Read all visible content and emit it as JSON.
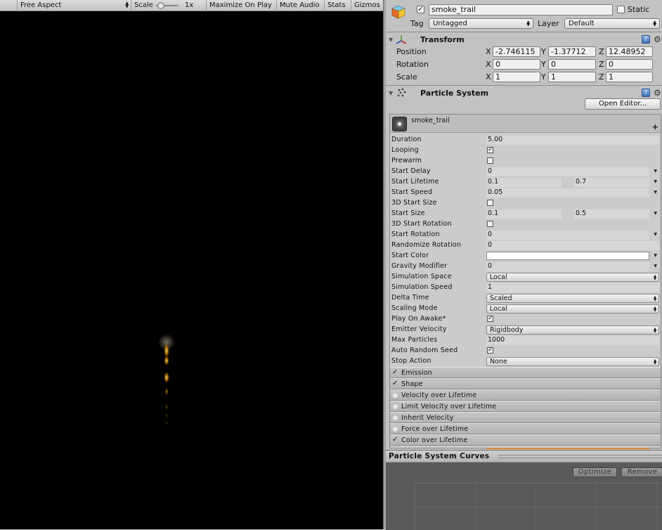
{
  "game_toolbar": {
    "aspect": "Free Aspect",
    "scale_label": "Scale",
    "scale_value": "1x",
    "maximize": "Maximize On Play",
    "mute": "Mute Audio",
    "stats": "Stats",
    "gizmos": "Gizmos"
  },
  "object": {
    "name": "smoke_trail",
    "static_label": "Static",
    "tag_label": "Tag",
    "tag_value": "Untagged",
    "layer_label": "Layer",
    "layer_value": "Default"
  },
  "transform": {
    "title": "Transform",
    "rows": [
      {
        "label": "Position",
        "x": "-2.746115",
        "y": "-1.37712",
        "z": "12.48952"
      },
      {
        "label": "Rotation",
        "x": "0",
        "y": "0",
        "z": "0"
      },
      {
        "label": "Scale",
        "x": "1",
        "y": "1",
        "z": "1"
      }
    ],
    "axes": [
      "X",
      "Y",
      "Z"
    ]
  },
  "particle_system": {
    "title": "Particle System",
    "open_editor": "Open Editor...",
    "system_name": "smoke_trail",
    "add": "+",
    "props": {
      "duration": {
        "label": "Duration",
        "value": "5.00"
      },
      "looping": {
        "label": "Looping"
      },
      "prewarm": {
        "label": "Prewarm"
      },
      "start_delay": {
        "label": "Start Delay",
        "value": "0"
      },
      "start_lifetime": {
        "label": "Start Lifetime",
        "min": "0.1",
        "max": "0.7"
      },
      "start_speed": {
        "label": "Start Speed",
        "value": "0.05"
      },
      "start_size_3d": {
        "label": "3D Start Size"
      },
      "start_size": {
        "label": "Start Size",
        "min": "0.1",
        "max": "0.5"
      },
      "start_rotation_3d": {
        "label": "3D Start Rotation"
      },
      "start_rotation": {
        "label": "Start Rotation",
        "value": "0"
      },
      "randomize_rotation": {
        "label": "Randomize Rotation",
        "value": "0"
      },
      "start_color": {
        "label": "Start Color",
        "value": "#ffffff"
      },
      "gravity": {
        "label": "Gravity Modifier",
        "value": "0"
      },
      "sim_space": {
        "label": "Simulation Space",
        "value": "Local"
      },
      "sim_speed": {
        "label": "Simulation Speed",
        "value": "1"
      },
      "delta_time": {
        "label": "Delta Time",
        "value": "Scaled"
      },
      "scaling_mode": {
        "label": "Scaling Mode",
        "value": "Local"
      },
      "play_on_awake": {
        "label": "Play On Awake*"
      },
      "emitter_velocity": {
        "label": "Emitter Velocity",
        "value": "Rigidbody"
      },
      "max_particles": {
        "label": "Max Particles",
        "value": "1000"
      },
      "auto_random_seed": {
        "label": "Auto Random Seed"
      },
      "stop_action": {
        "label": "Stop Action",
        "value": "None"
      }
    },
    "modules": [
      {
        "label": "Emission",
        "enabled": true
      },
      {
        "label": "Shape",
        "enabled": true
      },
      {
        "label": "Velocity over Lifetime",
        "enabled": false
      },
      {
        "label": "Limit Velocity over Lifetime",
        "enabled": false
      },
      {
        "label": "Inherit Velocity",
        "enabled": false
      },
      {
        "label": "Force over Lifetime",
        "enabled": false
      },
      {
        "label": "Color over Lifetime",
        "enabled": true
      }
    ]
  },
  "curves": {
    "title": "Particle System Curves",
    "optimize": "Optimize",
    "remove": "Remove"
  },
  "colors": {
    "game_bg": "#000000",
    "inspector_bg": "#c2c2c2",
    "particle": "#ffb000"
  }
}
